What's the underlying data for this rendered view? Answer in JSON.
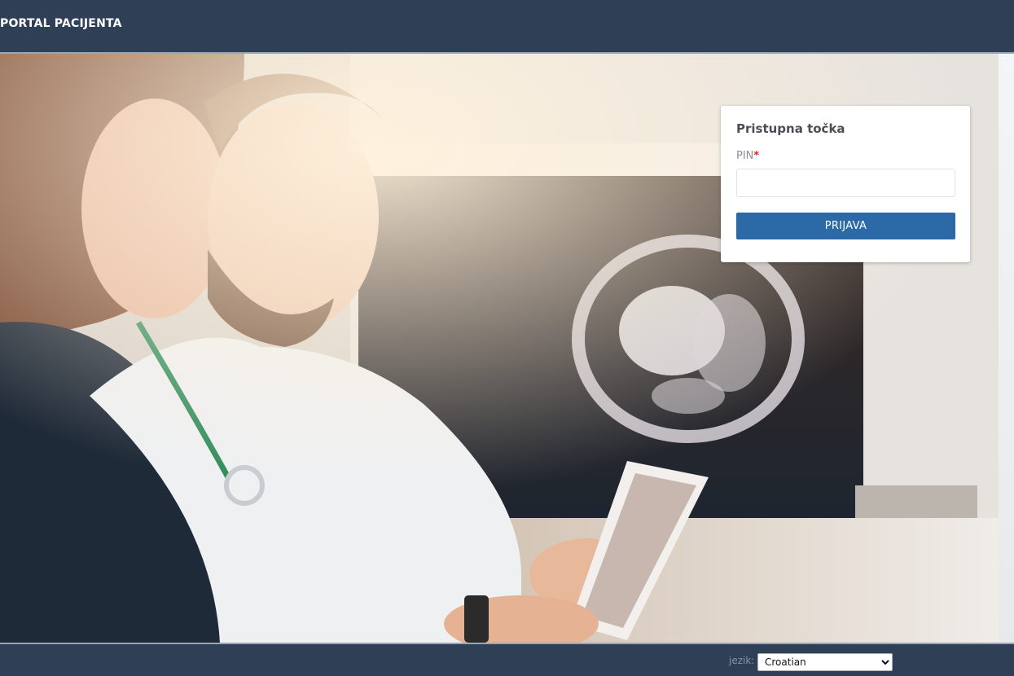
{
  "header": {
    "title": "PORTAL PACIJENTA"
  },
  "login": {
    "title": "Pristupna točka",
    "pin_label": "PIN",
    "required_mark": "*",
    "pin_value": "",
    "button_label": "PRIJAVA"
  },
  "footer": {
    "language_label": "jezik:",
    "language_selected": "Croatian",
    "language_options": [
      "Croatian"
    ]
  },
  "hero": {
    "description_icon": "doctor-patient-photo"
  },
  "colors": {
    "header_bg": "#2f3f56",
    "button_bg": "#2b6aa6",
    "required": "#d9262c"
  }
}
